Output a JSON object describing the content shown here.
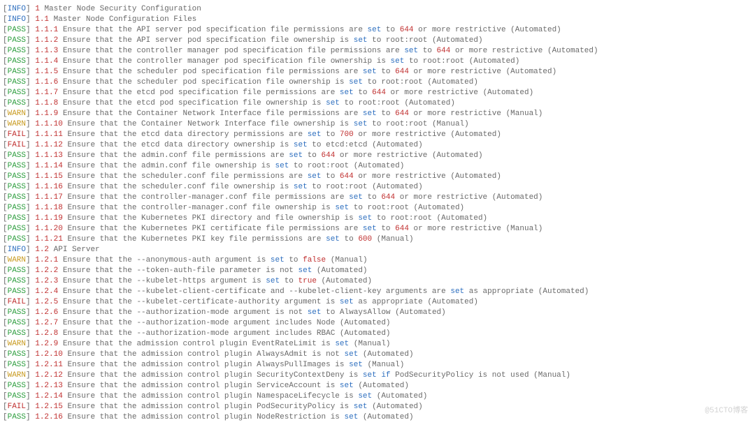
{
  "watermark": "@51CTO博客",
  "rows": [
    {
      "level": "INFO",
      "id": "1",
      "tokens": [
        {
          "t": "Master Node Security Configuration"
        }
      ]
    },
    {
      "level": "INFO",
      "id": "1.1",
      "tokens": [
        {
          "t": "Master Node Configuration Files"
        }
      ]
    },
    {
      "level": "PASS",
      "id": "1.1.1",
      "tokens": [
        {
          "t": "Ensure that the API server pod specification file permissions are "
        },
        {
          "t": "set",
          "c": "kw"
        },
        {
          "t": " to "
        },
        {
          "t": "644",
          "c": "lit"
        },
        {
          "t": " or more restrictive (Automated)"
        }
      ]
    },
    {
      "level": "PASS",
      "id": "1.1.2",
      "tokens": [
        {
          "t": "Ensure that the API server pod specification file ownership is "
        },
        {
          "t": "set",
          "c": "kw"
        },
        {
          "t": " to root:root (Automated)"
        }
      ]
    },
    {
      "level": "PASS",
      "id": "1.1.3",
      "tokens": [
        {
          "t": "Ensure that the controller manager pod specification file permissions are "
        },
        {
          "t": "set",
          "c": "kw"
        },
        {
          "t": " to "
        },
        {
          "t": "644",
          "c": "lit"
        },
        {
          "t": " or more restrictive (Automated)"
        }
      ]
    },
    {
      "level": "PASS",
      "id": "1.1.4",
      "tokens": [
        {
          "t": "Ensure that the controller manager pod specification file ownership is "
        },
        {
          "t": "set",
          "c": "kw"
        },
        {
          "t": " to root:root (Automated)"
        }
      ]
    },
    {
      "level": "PASS",
      "id": "1.1.5",
      "tokens": [
        {
          "t": "Ensure that the scheduler pod specification file permissions are "
        },
        {
          "t": "set",
          "c": "kw"
        },
        {
          "t": " to "
        },
        {
          "t": "644",
          "c": "lit"
        },
        {
          "t": " or more restrictive (Automated)"
        }
      ]
    },
    {
      "level": "PASS",
      "id": "1.1.6",
      "tokens": [
        {
          "t": "Ensure that the scheduler pod specification file ownership is "
        },
        {
          "t": "set",
          "c": "kw"
        },
        {
          "t": " to root:root (Automated)"
        }
      ]
    },
    {
      "level": "PASS",
      "id": "1.1.7",
      "tokens": [
        {
          "t": "Ensure that the etcd pod specification file permissions are "
        },
        {
          "t": "set",
          "c": "kw"
        },
        {
          "t": " to "
        },
        {
          "t": "644",
          "c": "lit"
        },
        {
          "t": " or more restrictive (Automated)"
        }
      ]
    },
    {
      "level": "PASS",
      "id": "1.1.8",
      "tokens": [
        {
          "t": "Ensure that the etcd pod specification file ownership is "
        },
        {
          "t": "set",
          "c": "kw"
        },
        {
          "t": " to root:root (Automated)"
        }
      ]
    },
    {
      "level": "WARN",
      "id": "1.1.9",
      "tokens": [
        {
          "t": "Ensure that the Container Network Interface file permissions are "
        },
        {
          "t": "set",
          "c": "kw"
        },
        {
          "t": " to "
        },
        {
          "t": "644",
          "c": "lit"
        },
        {
          "t": " or more restrictive (Manual)"
        }
      ]
    },
    {
      "level": "WARN",
      "id": "1.1.10",
      "tokens": [
        {
          "t": "Ensure that the Container Network Interface file ownership is "
        },
        {
          "t": "set",
          "c": "kw"
        },
        {
          "t": " to root:root (Manual)"
        }
      ]
    },
    {
      "level": "FAIL",
      "id": "1.1.11",
      "tokens": [
        {
          "t": "Ensure that the etcd data directory permissions are "
        },
        {
          "t": "set",
          "c": "kw"
        },
        {
          "t": " to "
        },
        {
          "t": "700",
          "c": "lit"
        },
        {
          "t": " or more restrictive (Automated)"
        }
      ]
    },
    {
      "level": "FAIL",
      "id": "1.1.12",
      "tokens": [
        {
          "t": "Ensure that the etcd data directory ownership is "
        },
        {
          "t": "set",
          "c": "kw"
        },
        {
          "t": " to etcd:etcd (Automated)"
        }
      ]
    },
    {
      "level": "PASS",
      "id": "1.1.13",
      "tokens": [
        {
          "t": "Ensure that the admin.conf file permissions are "
        },
        {
          "t": "set",
          "c": "kw"
        },
        {
          "t": " to "
        },
        {
          "t": "644",
          "c": "lit"
        },
        {
          "t": " or more restrictive (Automated)"
        }
      ]
    },
    {
      "level": "PASS",
      "id": "1.1.14",
      "tokens": [
        {
          "t": "Ensure that the admin.conf file ownership is "
        },
        {
          "t": "set",
          "c": "kw"
        },
        {
          "t": " to root:root (Automated)"
        }
      ]
    },
    {
      "level": "PASS",
      "id": "1.1.15",
      "tokens": [
        {
          "t": "Ensure that the scheduler.conf file permissions are "
        },
        {
          "t": "set",
          "c": "kw"
        },
        {
          "t": " to "
        },
        {
          "t": "644",
          "c": "lit"
        },
        {
          "t": " or more restrictive (Automated)"
        }
      ]
    },
    {
      "level": "PASS",
      "id": "1.1.16",
      "tokens": [
        {
          "t": "Ensure that the scheduler.conf file ownership is "
        },
        {
          "t": "set",
          "c": "kw"
        },
        {
          "t": " to root:root (Automated)"
        }
      ]
    },
    {
      "level": "PASS",
      "id": "1.1.17",
      "tokens": [
        {
          "t": "Ensure that the controller-manager.conf file permissions are "
        },
        {
          "t": "set",
          "c": "kw"
        },
        {
          "t": " to "
        },
        {
          "t": "644",
          "c": "lit"
        },
        {
          "t": " or more restrictive (Automated)"
        }
      ]
    },
    {
      "level": "PASS",
      "id": "1.1.18",
      "tokens": [
        {
          "t": "Ensure that the controller-manager.conf file ownership is "
        },
        {
          "t": "set",
          "c": "kw"
        },
        {
          "t": " to root:root (Automated)"
        }
      ]
    },
    {
      "level": "PASS",
      "id": "1.1.19",
      "tokens": [
        {
          "t": "Ensure that the Kubernetes PKI directory and file ownership is "
        },
        {
          "t": "set",
          "c": "kw"
        },
        {
          "t": " to root:root (Automated)"
        }
      ]
    },
    {
      "level": "PASS",
      "id": "1.1.20",
      "tokens": [
        {
          "t": "Ensure that the Kubernetes PKI certificate file permissions are "
        },
        {
          "t": "set",
          "c": "kw"
        },
        {
          "t": " to "
        },
        {
          "t": "644",
          "c": "lit"
        },
        {
          "t": " or more restrictive (Manual)"
        }
      ]
    },
    {
      "level": "PASS",
      "id": "1.1.21",
      "tokens": [
        {
          "t": "Ensure that the Kubernetes PKI key file permissions are "
        },
        {
          "t": "set",
          "c": "kw"
        },
        {
          "t": " to "
        },
        {
          "t": "600",
          "c": "lit"
        },
        {
          "t": " (Manual)"
        }
      ]
    },
    {
      "level": "INFO",
      "id": "1.2",
      "tokens": [
        {
          "t": "API Server"
        }
      ]
    },
    {
      "level": "WARN",
      "id": "1.2.1",
      "tokens": [
        {
          "t": "Ensure that the --anonymous-auth argument is "
        },
        {
          "t": "set",
          "c": "kw"
        },
        {
          "t": " to "
        },
        {
          "t": "false",
          "c": "lit"
        },
        {
          "t": " (Manual)"
        }
      ]
    },
    {
      "level": "PASS",
      "id": "1.2.2",
      "tokens": [
        {
          "t": "Ensure that the --token-auth-file parameter is not "
        },
        {
          "t": "set",
          "c": "kw"
        },
        {
          "t": " (Automated)"
        }
      ]
    },
    {
      "level": "PASS",
      "id": "1.2.3",
      "tokens": [
        {
          "t": "Ensure that the --kubelet-https argument is "
        },
        {
          "t": "set",
          "c": "kw"
        },
        {
          "t": " to "
        },
        {
          "t": "true",
          "c": "lit"
        },
        {
          "t": " (Automated)"
        }
      ]
    },
    {
      "level": "PASS",
      "id": "1.2.4",
      "tokens": [
        {
          "t": "Ensure that the --kubelet-client-certificate and --kubelet-client-key arguments are "
        },
        {
          "t": "set",
          "c": "kw"
        },
        {
          "t": " as appropriate (Automated)"
        }
      ]
    },
    {
      "level": "FAIL",
      "id": "1.2.5",
      "tokens": [
        {
          "t": "Ensure that the --kubelet-certificate-authority argument is "
        },
        {
          "t": "set",
          "c": "kw"
        },
        {
          "t": " as appropriate (Automated)"
        }
      ]
    },
    {
      "level": "PASS",
      "id": "1.2.6",
      "tokens": [
        {
          "t": "Ensure that the --authorization-mode argument is not "
        },
        {
          "t": "set",
          "c": "kw"
        },
        {
          "t": " to AlwaysAllow (Automated)"
        }
      ]
    },
    {
      "level": "PASS",
      "id": "1.2.7",
      "tokens": [
        {
          "t": "Ensure that the --authorization-mode argument includes Node (Automated)"
        }
      ]
    },
    {
      "level": "PASS",
      "id": "1.2.8",
      "tokens": [
        {
          "t": "Ensure that the --authorization-mode argument includes RBAC (Automated)"
        }
      ]
    },
    {
      "level": "WARN",
      "id": "1.2.9",
      "tokens": [
        {
          "t": "Ensure that the admission control plugin EventRateLimit is "
        },
        {
          "t": "set",
          "c": "kw"
        },
        {
          "t": " (Manual)"
        }
      ]
    },
    {
      "level": "PASS",
      "id": "1.2.10",
      "tokens": [
        {
          "t": "Ensure that the admission control plugin AlwaysAdmit is not "
        },
        {
          "t": "set",
          "c": "kw"
        },
        {
          "t": " (Automated)"
        }
      ]
    },
    {
      "level": "PASS",
      "id": "1.2.11",
      "tokens": [
        {
          "t": "Ensure that the admission control plugin AlwaysPullImages is "
        },
        {
          "t": "set",
          "c": "kw"
        },
        {
          "t": " (Manual)"
        }
      ]
    },
    {
      "level": "WARN",
      "id": "1.2.12",
      "tokens": [
        {
          "t": "Ensure that the admission control plugin SecurityContextDeny is "
        },
        {
          "t": "set",
          "c": "kw"
        },
        {
          "t": " "
        },
        {
          "t": "if",
          "c": "kw"
        },
        {
          "t": " PodSecurityPolicy is not used (Manual)"
        }
      ]
    },
    {
      "level": "PASS",
      "id": "1.2.13",
      "tokens": [
        {
          "t": "Ensure that the admission control plugin ServiceAccount is "
        },
        {
          "t": "set",
          "c": "kw"
        },
        {
          "t": " (Automated)"
        }
      ]
    },
    {
      "level": "PASS",
      "id": "1.2.14",
      "tokens": [
        {
          "t": "Ensure that the admission control plugin NamespaceLifecycle is "
        },
        {
          "t": "set",
          "c": "kw"
        },
        {
          "t": " (Automated)"
        }
      ]
    },
    {
      "level": "FAIL",
      "id": "1.2.15",
      "tokens": [
        {
          "t": "Ensure that the admission control plugin PodSecurityPolicy is "
        },
        {
          "t": "set",
          "c": "kw"
        },
        {
          "t": " (Automated)"
        }
      ]
    },
    {
      "level": "PASS",
      "id": "1.2.16",
      "tokens": [
        {
          "t": "Ensure that the admission control plugin NodeRestriction is "
        },
        {
          "t": "set",
          "c": "kw"
        },
        {
          "t": " (Automated)"
        }
      ]
    }
  ]
}
